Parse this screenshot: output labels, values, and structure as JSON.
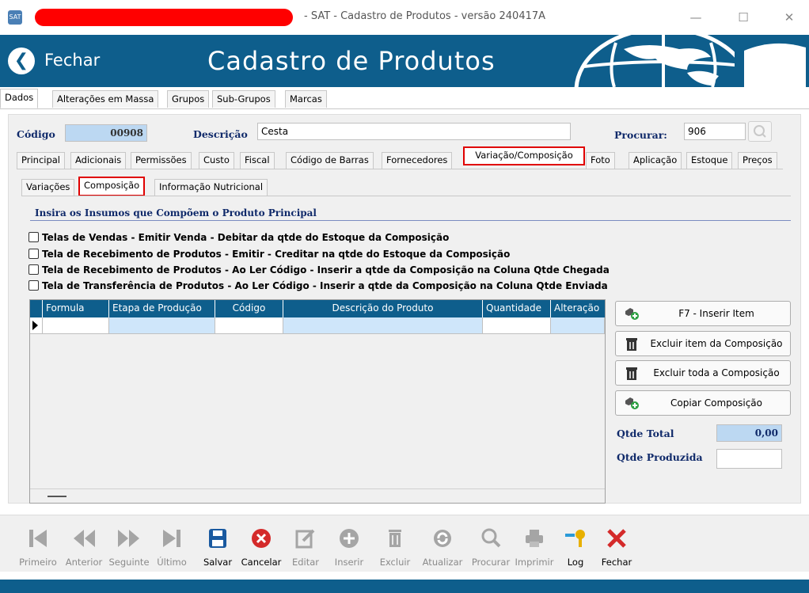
{
  "window": {
    "title": "- SAT - Cadastro de Produtos - versão 240417A",
    "minimize": "—",
    "maximize": "☐",
    "close": "✕"
  },
  "header": {
    "back_label": "Fechar",
    "title": "Cadastro de Produtos"
  },
  "menu_tabs": [
    "Dados",
    "Alterações em Massa",
    "Grupos",
    "Sub-Grupos",
    "Marcas"
  ],
  "form": {
    "codigo_label": "Código",
    "codigo_value": "00908",
    "descricao_label": "Descrição",
    "descricao_value": "Cesta",
    "procurar_label": "Procurar:",
    "procurar_value": "906"
  },
  "tabs": [
    "Principal",
    "Adicionais",
    "Permissões",
    "Custo",
    "Fiscal",
    "Código de Barras",
    "Fornecedores",
    "Variação/Composição",
    "Foto",
    "Aplicação",
    "Estoque",
    "Preços"
  ],
  "subtabs": [
    "Variações",
    "Composição",
    "Informação Nutricional"
  ],
  "section": {
    "title": "Insira os Insumos que Compõem o Produto Principal",
    "checkboxes": [
      "Telas de Vendas - Emitir Venda - Debitar da qtde do Estoque da Composição",
      "Tela de Recebimento de Produtos - Emitir - Creditar na qtde do Estoque da Composição",
      "Tela de Recebimento de Produtos - Ao Ler Código - Inserir a qtde da Composição na Coluna Qtde Chegada",
      "Tela de Transferência de Produtos - Ao Ler Código - Inserir a qtde da Composição na Coluna Qtde Enviada"
    ]
  },
  "grid": {
    "columns": [
      "Formula",
      "Etapa de Produção",
      "Código",
      "Descrição do Produto",
      "Quantidade",
      "Alteração"
    ]
  },
  "buttons": {
    "insert_item": "F7 - Inserir Item",
    "delete_item": "Excluir item da Composição",
    "delete_all": "Excluir toda a Composição",
    "copy": "Copiar Composição"
  },
  "totals": {
    "qtde_total_label": "Qtde Total",
    "qtde_total_value": "0,00",
    "qtde_produzida_label": "Qtde Produzida",
    "qtde_produzida_value": ""
  },
  "toolbar": [
    "Primeiro",
    "Anterior",
    "Seguinte",
    "Último",
    "Salvar",
    "Cancelar",
    "Editar",
    "Inserir",
    "Excluir",
    "Atualizar",
    "Procurar",
    "Imprimir",
    "Log",
    "Fechar"
  ],
  "colors": {
    "brand_blue": "#0e5e8c",
    "highlight_red": "#e00000",
    "label_navy": "#102a6a"
  }
}
